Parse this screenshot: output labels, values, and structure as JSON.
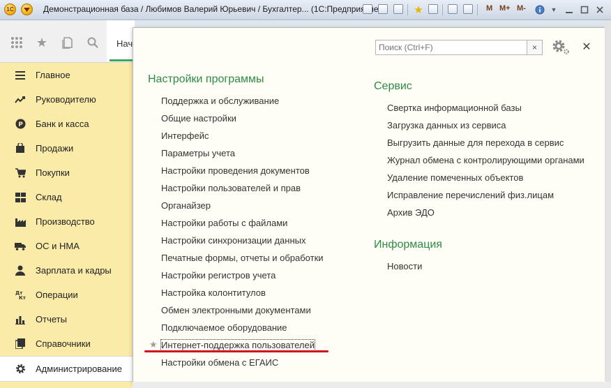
{
  "window": {
    "title": "Демонстрационная база / Любимов Валерий Юрьевич / Бухгалтер... (1С:Предприятие)",
    "app_logo": "1С",
    "memory_buttons": [
      "M",
      "M+",
      "M-"
    ]
  },
  "tabs": {
    "start_label": "Нач"
  },
  "sidebar": {
    "items": [
      {
        "label": "Главное",
        "icon": "menu-lines-icon"
      },
      {
        "label": "Руководителю",
        "icon": "trend-icon"
      },
      {
        "label": "Банк и касса",
        "icon": "ruble-coin-icon"
      },
      {
        "label": "Продажи",
        "icon": "shopping-bag-icon"
      },
      {
        "label": "Покупки",
        "icon": "cart-icon"
      },
      {
        "label": "Склад",
        "icon": "warehouse-icon"
      },
      {
        "label": "Производство",
        "icon": "factory-icon"
      },
      {
        "label": "ОС и НМА",
        "icon": "truck-icon"
      },
      {
        "label": "Зарплата и кадры",
        "icon": "person-icon"
      },
      {
        "label": "Операции",
        "icon": "debit-credit-icon"
      },
      {
        "label": "Отчеты",
        "icon": "bar-chart-icon"
      },
      {
        "label": "Справочники",
        "icon": "books-icon"
      },
      {
        "label": "Администрирование",
        "icon": "gear-icon"
      }
    ]
  },
  "panel": {
    "search_placeholder": "Поиск (Ctrl+F)",
    "program_settings": {
      "title": "Настройки программы",
      "links": [
        "Поддержка и обслуживание",
        "Общие настройки",
        "Интерфейс",
        "Параметры учета",
        "Настройки проведения документов",
        "Настройки пользователей и прав",
        "Органайзер",
        "Настройки работы с файлами",
        "Настройки синхронизации данных",
        "Печатные формы, отчеты и обработки",
        "Настройки регистров учета",
        "Настройка колонтитулов",
        "Обмен электронными документами",
        "Подключаемое оборудование",
        "Интернет-поддержка пользователей",
        "Настройки обмена с ЕГАИС"
      ]
    },
    "service": {
      "title": "Сервис",
      "links": [
        "Свертка информационной базы",
        "Загрузка данных из сервиса",
        "Выгрузить данные для перехода в сервис",
        "Журнал обмена с контролирующими органами",
        "Удаление помеченных объектов",
        "Исправление перечислений физ.лицам",
        "Архив ЭДО"
      ]
    },
    "info": {
      "title": "Информация",
      "links": [
        "Новости"
      ]
    }
  },
  "colors": {
    "sidebar_bg": "#fbeba8",
    "section_title": "#2e8b46",
    "highlight_underline": "#d0121b"
  }
}
